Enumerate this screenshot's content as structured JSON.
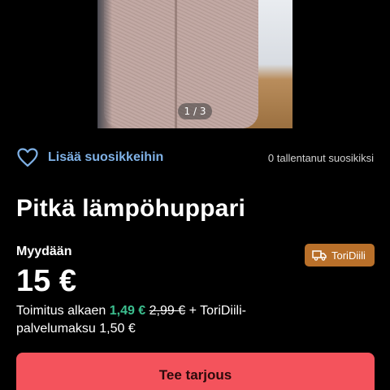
{
  "gallery": {
    "counter": "1 / 3"
  },
  "favorite": {
    "icon": "heart-icon",
    "label": "Lisää suosikkeihin",
    "count_text": "0 tallentanut suosikiksi",
    "accent": "#7fb1e6"
  },
  "listing": {
    "title": "Pitkä lämpöhuppari",
    "sale_type": "Myydään",
    "price": "15 €",
    "badge": {
      "icon": "truck-icon",
      "label": "ToriDiili",
      "color": "#b9702a"
    },
    "shipping": {
      "prefix": "Toimitus alkaen ",
      "discounted_price": "1,49 €",
      "original_price": "2,99 €",
      "suffix": " + ToriDiili-palvelumaksu 1,50 €"
    }
  },
  "actions": {
    "offer_label": "Tee tarjous",
    "offer_color": "#f4535c"
  }
}
